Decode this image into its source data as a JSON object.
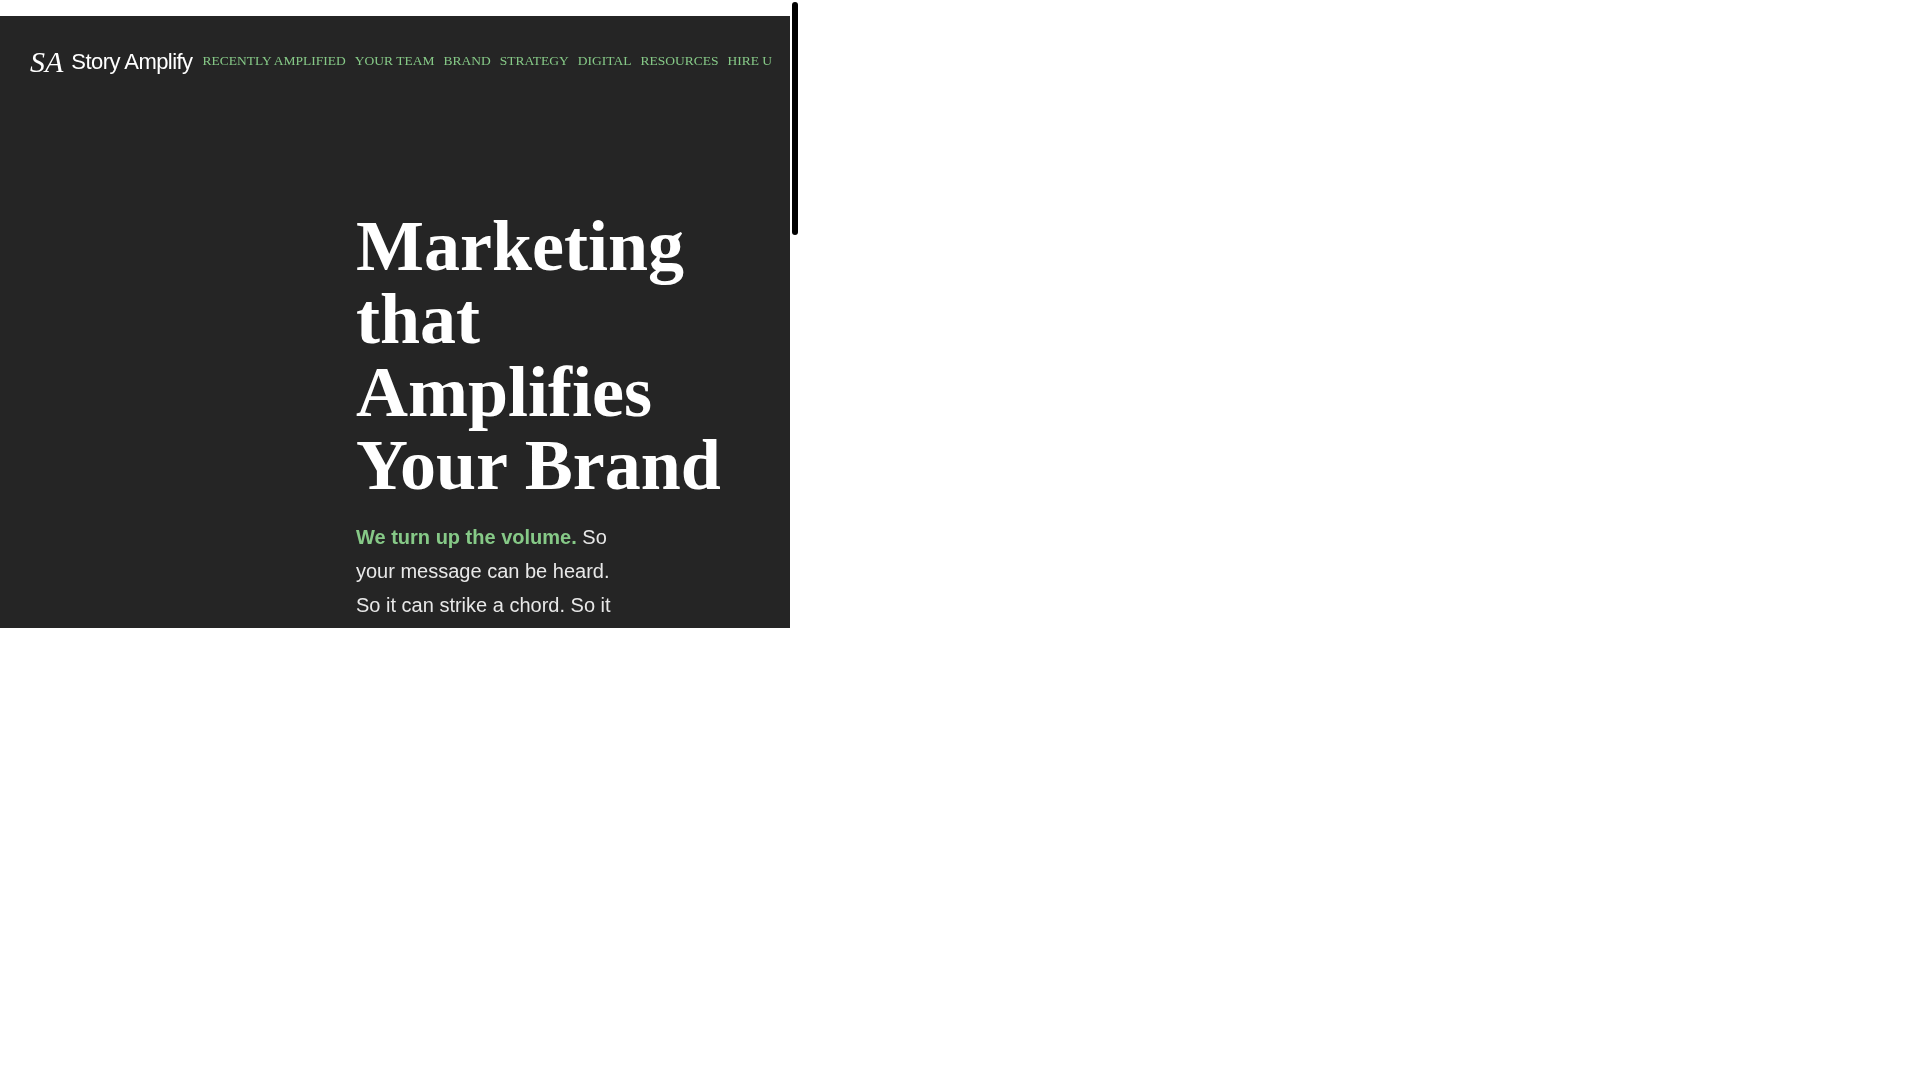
{
  "logo": {
    "monogram": "SA",
    "wordmark": "Story Amplify"
  },
  "nav": [
    {
      "label": "RECENTLY AMPLIFIED"
    },
    {
      "label": "YOUR TEAM"
    },
    {
      "label": "BRAND"
    },
    {
      "label": "STRATEGY"
    },
    {
      "label": "DIGITAL"
    },
    {
      "label": "RESOURCES"
    },
    {
      "label": "HIRE U"
    }
  ],
  "hero": {
    "heading_lines": [
      "Marketing",
      "that",
      "Amplifies",
      "Your Brand"
    ],
    "lead": "We turn up the volume.",
    "body": "So your message can be heard. So it can strike a chord. So it"
  }
}
